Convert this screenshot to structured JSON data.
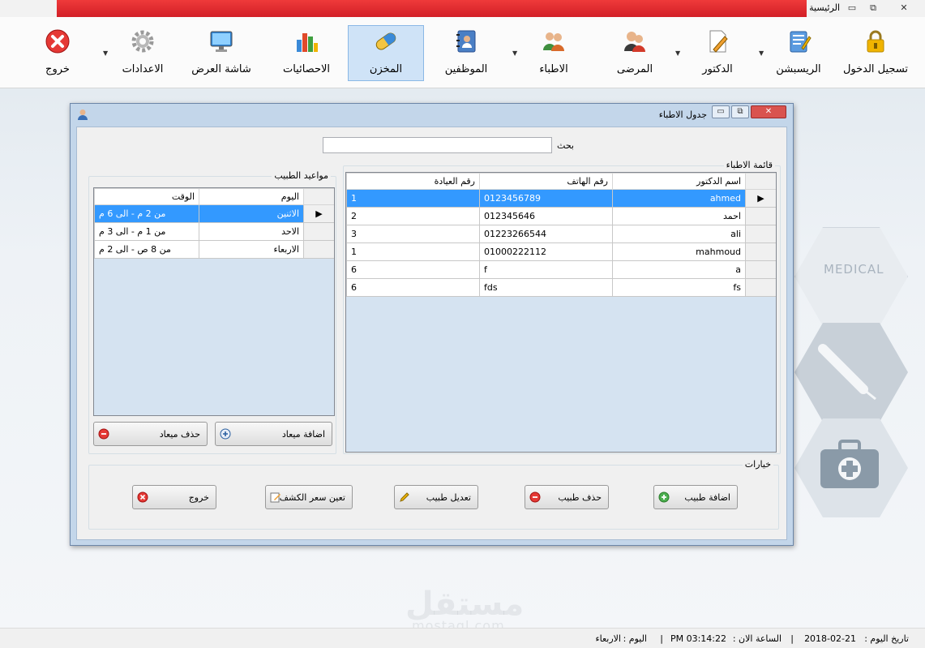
{
  "window": {
    "title": "الرئيسية",
    "controls": {
      "minimize": "▭",
      "restore": "⧉",
      "close": "✕"
    }
  },
  "ribbon": {
    "items": [
      {
        "label": "تسجيل الدخول",
        "icon": "lock-icon",
        "color": "#f0b400"
      },
      {
        "label": "الريسبشن",
        "icon": "notepad-pencil-icon",
        "color": "#3a7bd5"
      },
      {
        "label": "الدكتور",
        "icon": "pencil-document-icon",
        "color": "#e0a030"
      },
      {
        "label": "المرضى",
        "icon": "people-icon",
        "color": "#d23a2a"
      },
      {
        "label": "الاطباء",
        "icon": "doctors-icon",
        "color": "#3f8f3f"
      },
      {
        "label": "الموظفين",
        "icon": "address-book-icon",
        "color": "#3a6fb5"
      },
      {
        "label": "المخزن",
        "icon": "capsule-icon",
        "color": "#3a8ad8"
      },
      {
        "label": "الاحصائيات",
        "icon": "bar-chart-icon",
        "color": "#e04a2a"
      },
      {
        "label": "شاشة العرض",
        "icon": "monitor-icon",
        "color": "#2a7fd0"
      },
      {
        "label": "الاعدادات",
        "icon": "gear-icon",
        "color": "#9a9a9a"
      },
      {
        "label": "خروج",
        "icon": "close-circle-icon",
        "color": "#e53935"
      }
    ],
    "active_label": "المخزن"
  },
  "background": {
    "word": "MEDICAL",
    "watermark": "مستقل",
    "watermark_url": "mostaql.com"
  },
  "dialog": {
    "title": "جدول الاطباء",
    "controls": {
      "minimize": "▭",
      "restore": "⧉",
      "close": "✕"
    },
    "search_label": "بحث",
    "search_value": "",
    "doctors_group_label": "قائمة الاطباء",
    "doctors_columns": [
      "اسم الدكتور",
      "رقم الهاتف",
      "رقم العيادة"
    ],
    "doctors": [
      {
        "name": "ahmed",
        "phone": "0123456789",
        "clinic": "1",
        "selected": true
      },
      {
        "name": "احمد",
        "phone": "012345646",
        "clinic": "2",
        "selected": false
      },
      {
        "name": "ali",
        "phone": "01223266544",
        "clinic": "3",
        "selected": false
      },
      {
        "name": "mahmoud",
        "phone": "01000222112",
        "clinic": "1",
        "selected": false
      },
      {
        "name": "a",
        "phone": "f",
        "clinic": "6",
        "selected": false
      },
      {
        "name": "fs",
        "phone": "fds",
        "clinic": "6",
        "selected": false
      }
    ],
    "appointments_group_label": "مواعيد الطبيب",
    "appointments_columns": [
      "اليوم",
      "الوقت"
    ],
    "appointments": [
      {
        "day": "الاثنين",
        "time": "من 2 م - الى 6 م",
        "selected": true
      },
      {
        "day": "الاحد",
        "time": "من 1 م - الى 3 م",
        "selected": false
      },
      {
        "day": "الاربعاء",
        "time": "من 8 ص - الى 2 م",
        "selected": false
      }
    ],
    "add_appointment": "اضافة ميعاد",
    "delete_appointment": "حذف ميعاد",
    "options_group_label": "خيارات",
    "buttons": {
      "add_doctor": "اضافة طبيب",
      "delete_doctor": "حذف طبيب",
      "edit_doctor": "تعديل طبيب",
      "set_price": "تعين سعر الكشف",
      "exit": "خروج"
    }
  },
  "status": {
    "date_label": "تاريخ اليوم :",
    "date": "2018-02-21",
    "time_label": "الساعة الان :",
    "time": "03:14:22 PM",
    "day_label": "اليوم :",
    "day": "الاربعاء",
    "separator": "|"
  }
}
